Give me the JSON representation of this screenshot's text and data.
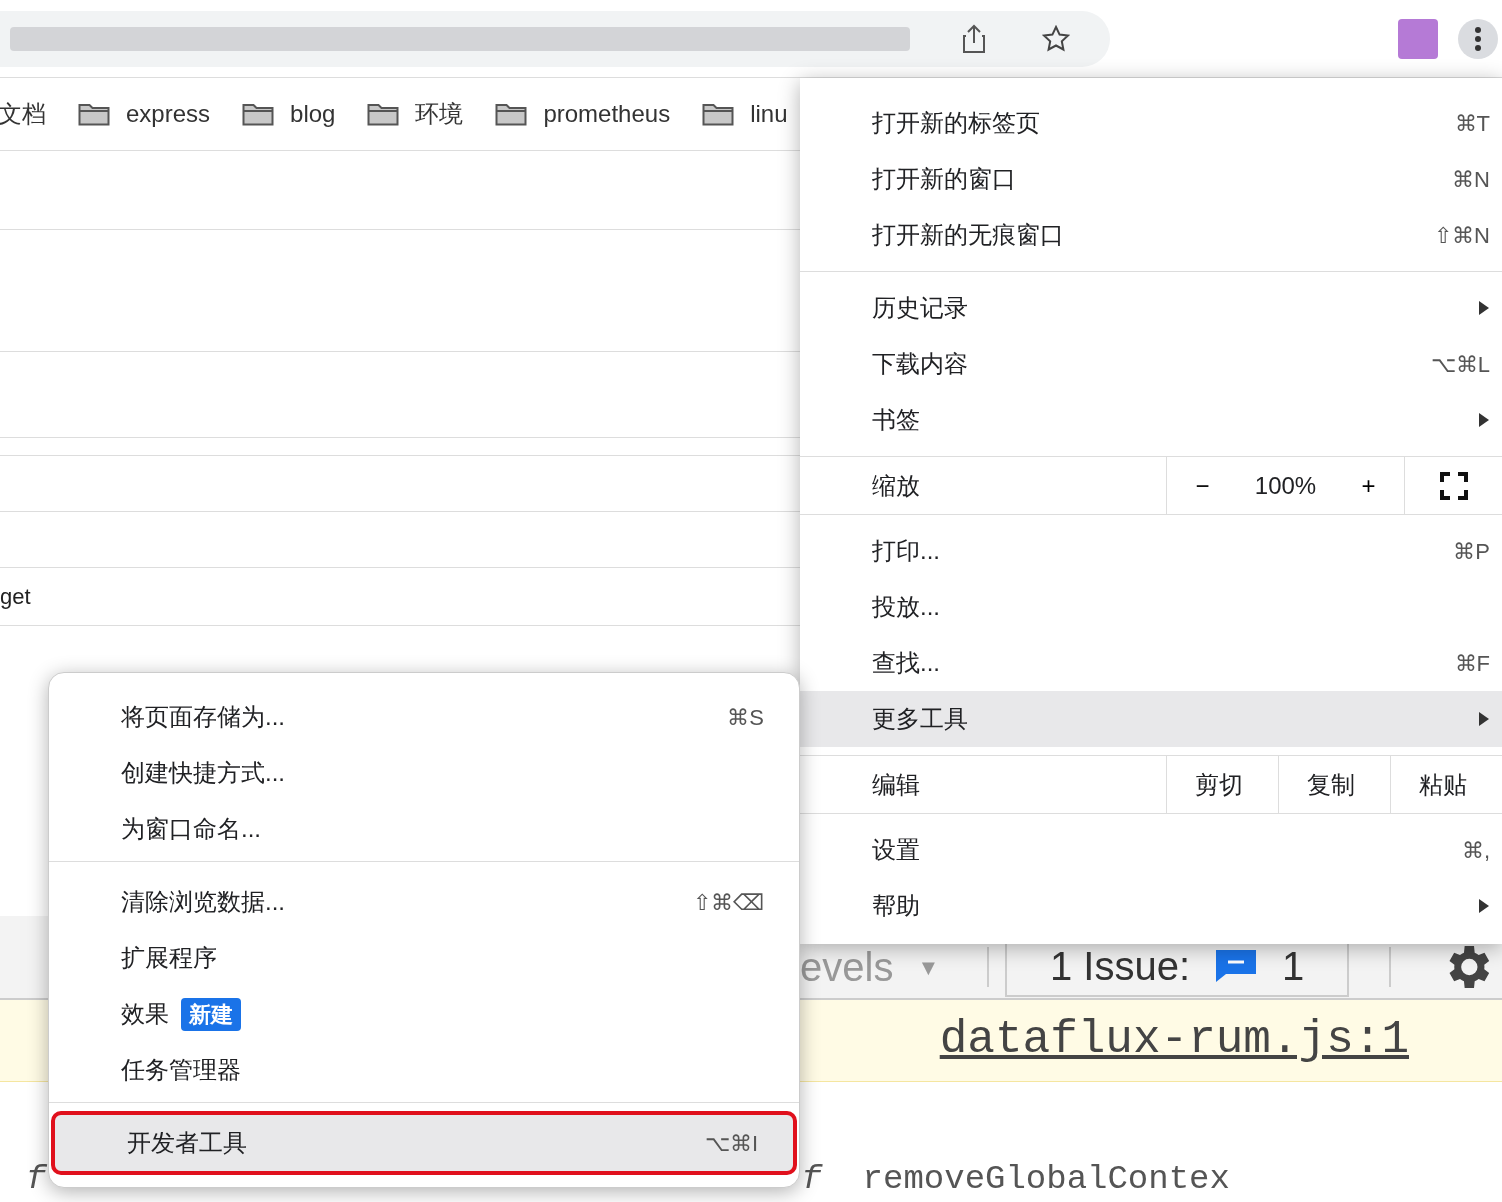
{
  "bookmarks": [
    {
      "label": "文档",
      "folder": false
    },
    {
      "label": "express",
      "folder": true
    },
    {
      "label": "blog",
      "folder": true
    },
    {
      "label": "环境",
      "folder": true
    },
    {
      "label": "prometheus",
      "folder": true
    },
    {
      "label": "linu",
      "folder": true
    }
  ],
  "content_rows": [
    "",
    "",
    "",
    "",
    "",
    "",
    "get"
  ],
  "devtools": {
    "levels_label": "evels",
    "levels_caret": "▼",
    "issues_label": "1 Issue:",
    "issues_count": "1",
    "source_link": "dataflux-rum.js:1",
    "code_left": "*f*",
    "code_right": "*f*  removeGlobalContex"
  },
  "main_menu": {
    "groups": [
      [
        {
          "kind": "item",
          "label": "打开新的标签页",
          "shortcut": "⌘T",
          "submenu": false,
          "selected": false
        },
        {
          "kind": "item",
          "label": "打开新的窗口",
          "shortcut": "⌘N",
          "submenu": false,
          "selected": false
        },
        {
          "kind": "item",
          "label": "打开新的无痕窗口",
          "shortcut": "⇧⌘N",
          "submenu": false,
          "selected": false
        }
      ],
      [
        {
          "kind": "item",
          "label": "历史记录",
          "submenu": true,
          "selected": false
        },
        {
          "kind": "item",
          "label": "下载内容",
          "shortcut": "⌥⌘L",
          "submenu": false,
          "selected": false
        },
        {
          "kind": "item",
          "label": "书签",
          "submenu": true,
          "selected": false
        }
      ],
      [
        {
          "kind": "zoom",
          "label": "缩放",
          "minus": "−",
          "value": "100%",
          "plus": "+"
        }
      ],
      [
        {
          "kind": "item",
          "label": "打印...",
          "shortcut": "⌘P",
          "submenu": false,
          "selected": false
        },
        {
          "kind": "item",
          "label": "投放...",
          "submenu": false,
          "selected": false
        },
        {
          "kind": "item",
          "label": "查找...",
          "shortcut": "⌘F",
          "submenu": false,
          "selected": false
        },
        {
          "kind": "item",
          "label": "更多工具",
          "submenu": true,
          "selected": true
        }
      ],
      [
        {
          "kind": "edit",
          "label": "编辑",
          "buttons": [
            "剪切",
            "复制",
            "粘贴"
          ]
        }
      ],
      [
        {
          "kind": "item",
          "label": "设置",
          "shortcut": "⌘,",
          "submenu": false,
          "selected": false
        },
        {
          "kind": "item",
          "label": "帮助",
          "submenu": true,
          "selected": false
        }
      ]
    ]
  },
  "more_tools_menu": {
    "groups": [
      [
        {
          "label": "将页面存储为...",
          "shortcut": "⌘S",
          "selected": false
        },
        {
          "label": "创建快捷方式...",
          "selected": false
        },
        {
          "label": "为窗口命名...",
          "selected": false
        }
      ],
      [
        {
          "label": "清除浏览数据...",
          "shortcut": "⇧⌘⌫",
          "selected": false
        },
        {
          "label": "扩展程序",
          "selected": false
        },
        {
          "label": "效果",
          "badge": "新建",
          "selected": false
        },
        {
          "label": "任务管理器",
          "selected": false
        }
      ],
      [
        {
          "label": "开发者工具",
          "shortcut": "⌥⌘I",
          "selected": true
        }
      ]
    ]
  }
}
